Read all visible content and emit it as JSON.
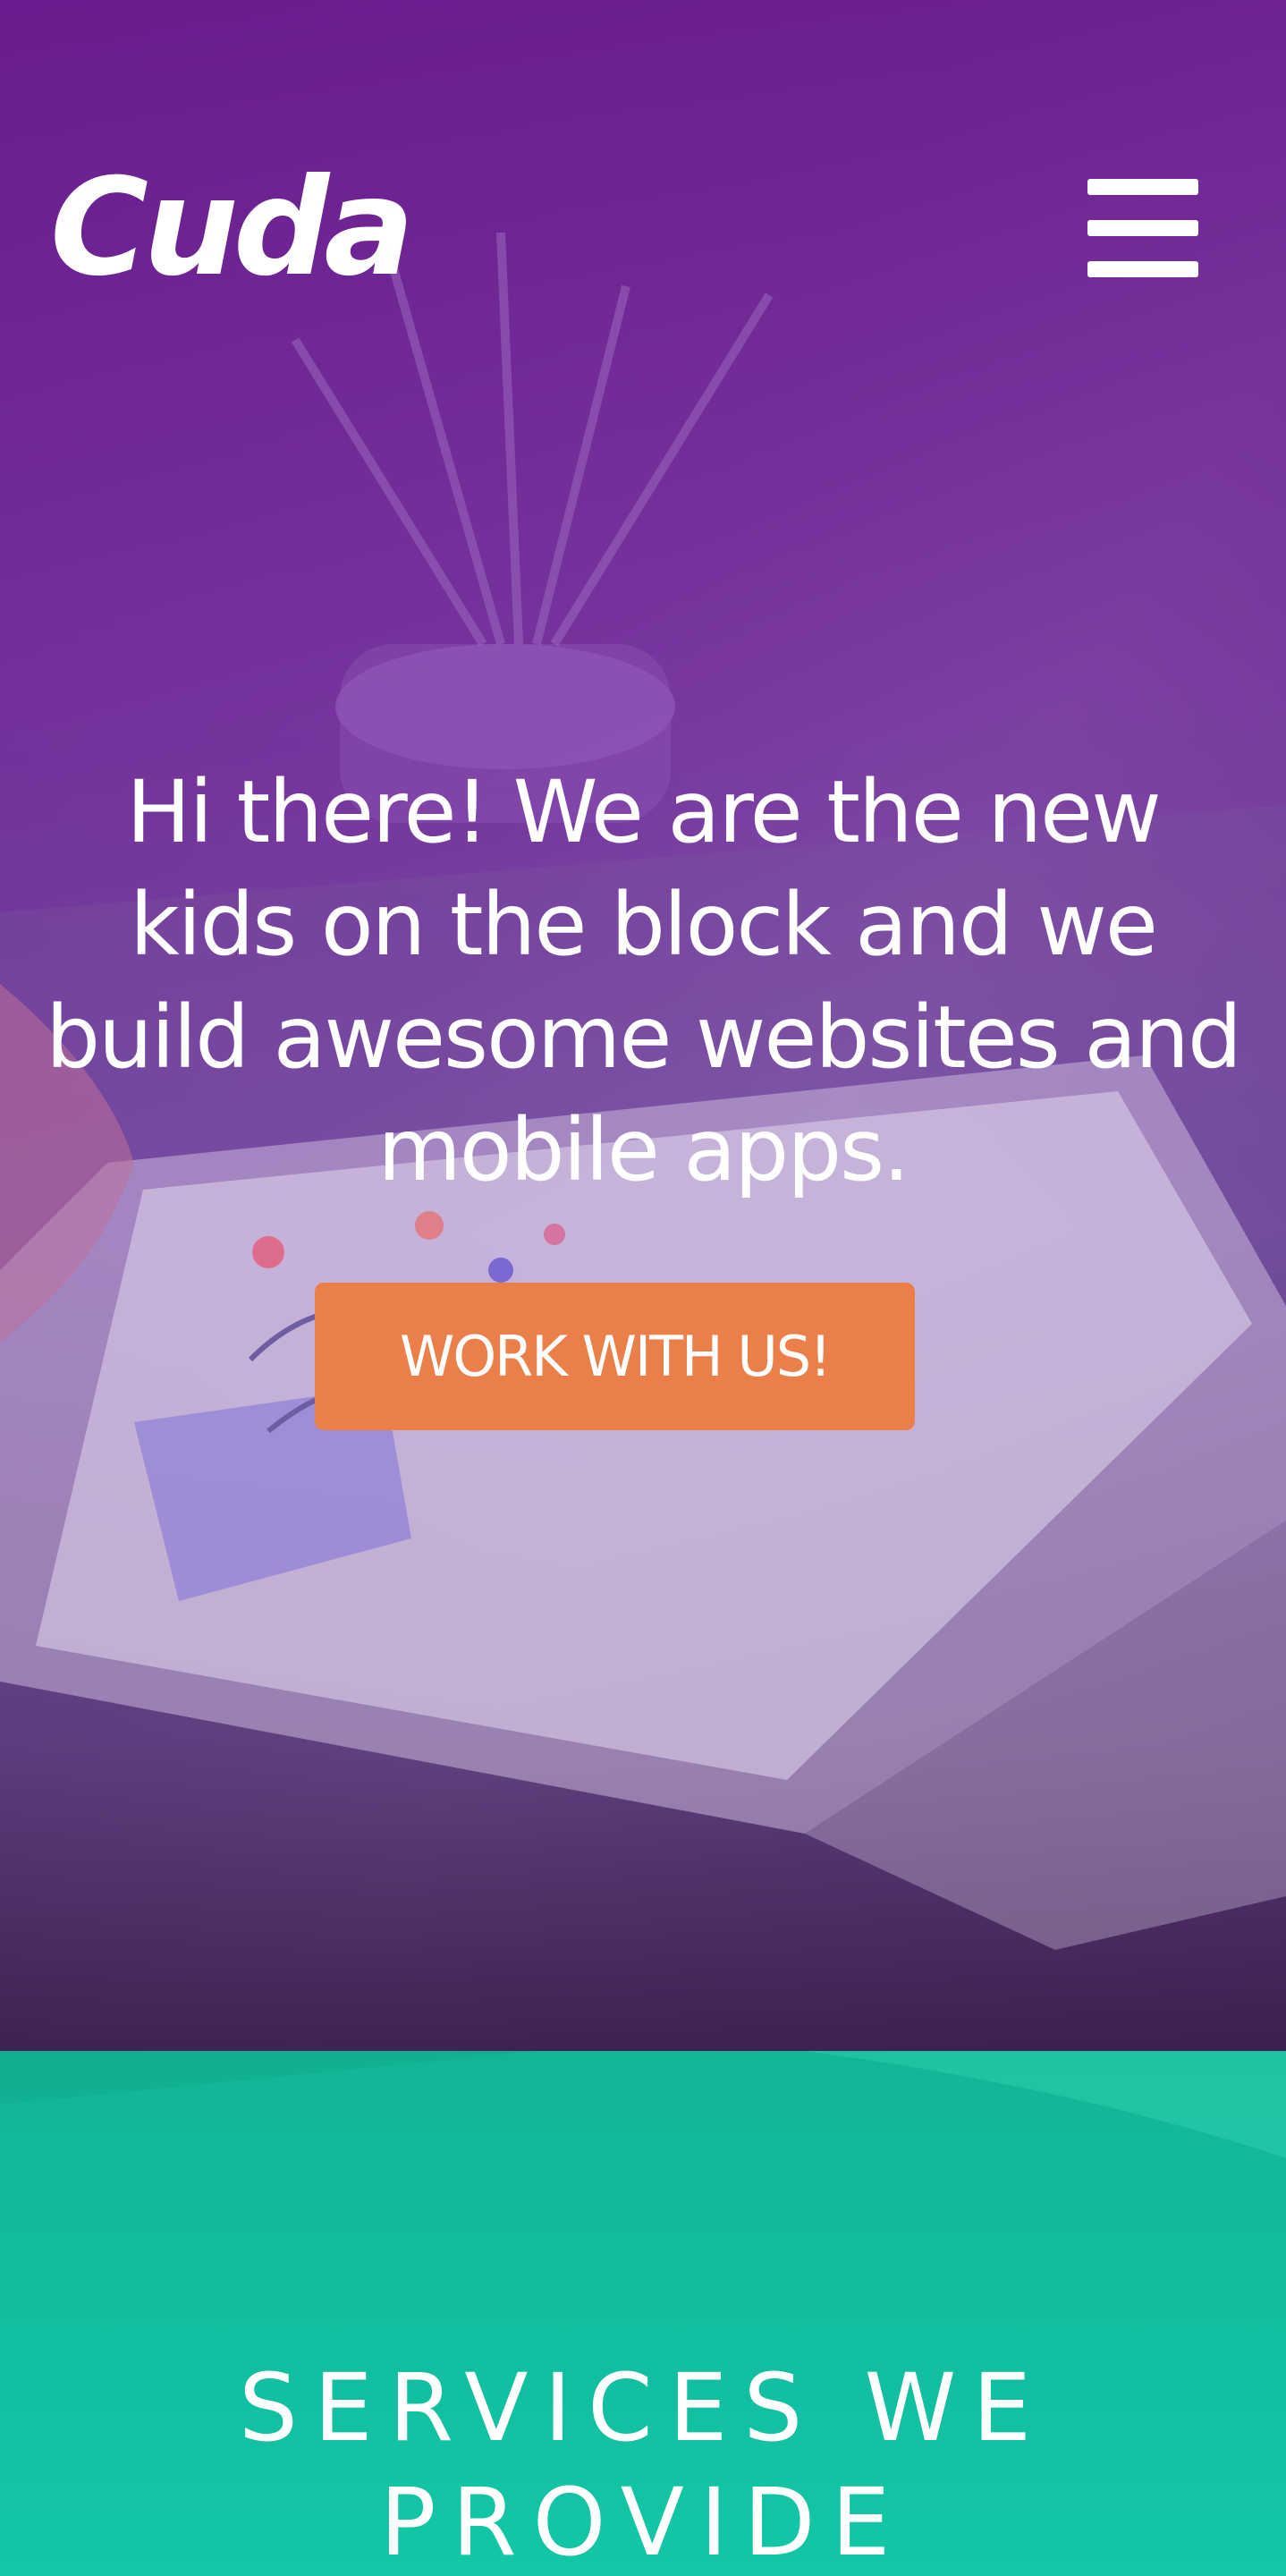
{
  "header": {
    "logo_text": "Cuda",
    "menu_icon": "hamburger-menu-icon"
  },
  "hero": {
    "headline": "Hi there! We are the new kids on the block and we build awesome websites and mobile apps.",
    "cta_label": "WORK WITH US!"
  },
  "services": {
    "title": "SERVICES WE PROVIDE"
  },
  "colors": {
    "hero_overlay": "#6a1a8c",
    "cta_background": "#eb7f4a",
    "services_background": "#12b89a",
    "text": "#ffffff"
  }
}
